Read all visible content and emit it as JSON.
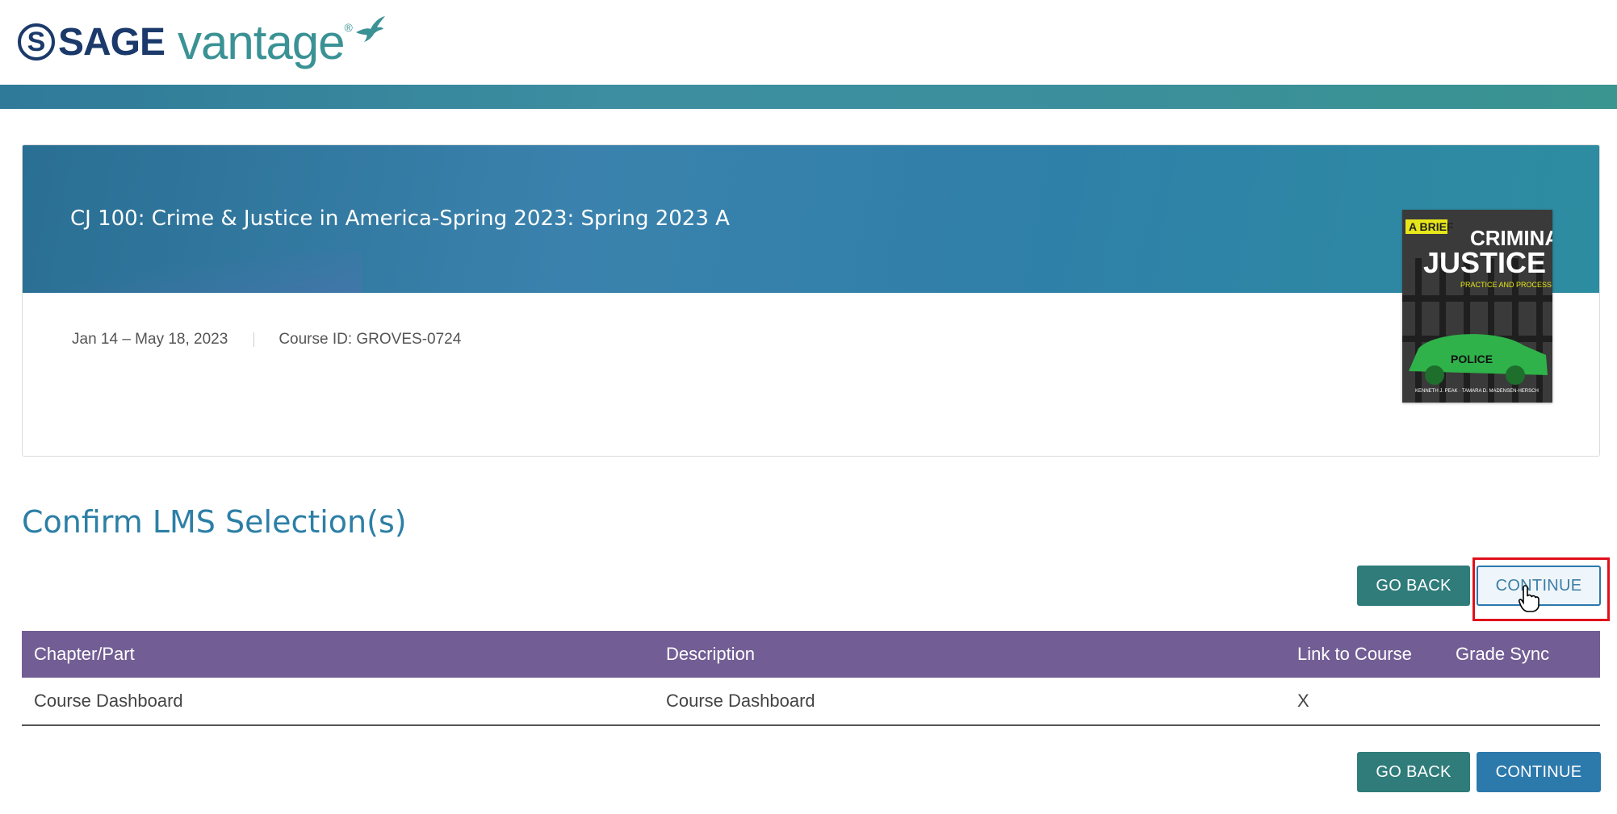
{
  "header": {
    "logo_s": "S",
    "logo_sage": "SAGE",
    "logo_vantage": "vantage",
    "logo_reg": "®"
  },
  "course": {
    "title": "CJ 100: Crime & Justice in America-Spring 2023: Spring 2023 A",
    "dates": "Jan 14 – May 18, 2023",
    "course_id": "Course ID: GROVES-0724",
    "book": {
      "tag": "A BRIEF",
      "title_line1": "CRIMINAL",
      "title_line2": "JUSTICE",
      "subtitle": "PRACTICE AND PROCESS",
      "car_label": "POLICE",
      "authors": "KENNETH J. PEAK · TAMARA D. MADENSEN-HERSCH"
    }
  },
  "section": {
    "title": "Confirm LMS Selection(s)"
  },
  "buttons": {
    "go_back": "GO BACK",
    "continue": "CONTINUE"
  },
  "table": {
    "columns": [
      "Chapter/Part",
      "Description",
      "Link to Course",
      "Grade Sync"
    ],
    "rows": [
      {
        "chapter": "Course Dashboard",
        "description": "Course Dashboard",
        "link": "X",
        "grade_sync": ""
      }
    ]
  },
  "colors": {
    "brand_navy": "#1b3a6b",
    "brand_teal": "#3a9295",
    "table_header": "#725e94",
    "go_back_button": "#2f7c7a",
    "continue_button": "#2c79ac",
    "highlight": "#e0101b"
  }
}
